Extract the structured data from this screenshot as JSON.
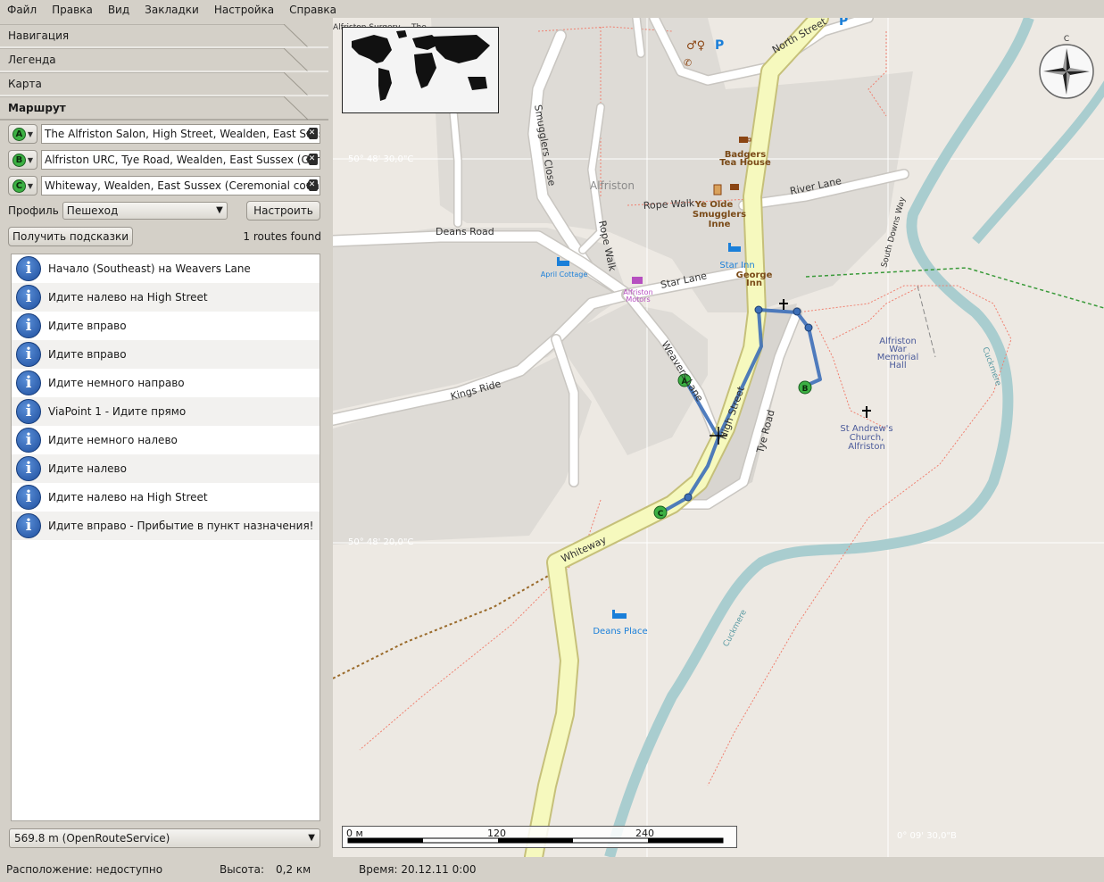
{
  "menu": [
    {
      "label": "Файл"
    },
    {
      "label": "Правка"
    },
    {
      "label": "Вид"
    },
    {
      "label": "Закладки"
    },
    {
      "label": "Настройка"
    },
    {
      "label": "Справка"
    }
  ],
  "panels": {
    "navigation": "Навигация",
    "legend": "Легенда",
    "map": "Карта",
    "route": "Маршрут"
  },
  "route": {
    "waypoints": [
      {
        "marker": "A",
        "value": "The Alfriston Salon, High Street, Wealden, East Sussex"
      },
      {
        "marker": "B",
        "value": "Alfriston URC, Tye Road, Wealden, East Sussex (Ceremonial county)"
      },
      {
        "marker": "C",
        "value": "Whiteway, Wealden, East Sussex (Ceremonial county), "
      }
    ],
    "profile_label": "Профиль",
    "profile_value": "Пешеход",
    "configure_button": "Настроить",
    "hints_button": "Получить подсказки",
    "routes_found": "1 routes found",
    "instructions": [
      "Начало (Southeast) на Weavers Lane",
      "Идите налево на High Street",
      "Идите вправо",
      "Идите вправо",
      "Идите немного направо",
      "ViaPoint 1 - Идите прямо",
      "Идите немного налево",
      "Идите налево",
      "Идите налево на High Street",
      "Идите вправо - Прибытие в пункт назначения!"
    ],
    "summary": "569.8 m (OpenRouteService)"
  },
  "status": {
    "location": "Расположение: недоступно",
    "altitude_label": "Высота:",
    "altitude_value": "0,2 км",
    "time": "Время: 20.12.11 0:00"
  },
  "map": {
    "grid_labels": {
      "lat1": "50° 48' 30,0\"С",
      "lat2": "50° 48' 20,0\"С",
      "lon1": "0° 09' 30,0\"В"
    },
    "compass_letter": "С",
    "scale": {
      "zero": "0 м",
      "mid": "120",
      "end": "240"
    },
    "streets": {
      "north_street": "North Street",
      "river_lane": "River Lane",
      "rope_walk": "Rope Walk",
      "rope_walk_v": "Rope Walk",
      "deans_road": "Deans Road",
      "star_lane": "Star Lane",
      "kings_ride": "Kings Ride",
      "smugglers_close": "Smugglers Close",
      "weavers_lane": "Weavers Lane",
      "high_street": "High Street",
      "tye_road": "Tye Road",
      "whiteway": "Whiteway",
      "south_downs_way": "South Downs Way",
      "cuckmere1": "Cuckmere",
      "cuckmere2": "Cuckmere"
    },
    "places": {
      "alfriston": "Alfriston",
      "alfriston_surgery": "Alfriston Surgery",
      "badgers1": "Badgers",
      "badgers2": "Tea House",
      "ye_olde1": "Ye Olde",
      "ye_olde2": "Smugglers",
      "ye_olde3": "Inne",
      "star_inn": "Star Inn",
      "george1": "George",
      "george2": "Inn",
      "april_cottage": "April Cottage",
      "alfriston_motors1": "Alfriston",
      "alfriston_motors2": "Motors",
      "war_memorial1": "Alfriston",
      "war_memorial2": "War",
      "war_memorial3": "Memorial",
      "war_memorial4": "Hall",
      "church1": "St Andrew's",
      "church2": "Church,",
      "church3": "Alfriston",
      "deans_place": "Deans Place",
      "the": "The"
    },
    "markers": {
      "a": "A",
      "b": "B",
      "c": "C"
    },
    "colors": {
      "main_road": "#f6f9be",
      "main_road_casing": "#c6c07a",
      "route": "#3d6fb8",
      "river": "#a9cdcf",
      "poi_blue": "#1a7fd9",
      "poi_brown": "#8b4513"
    }
  }
}
